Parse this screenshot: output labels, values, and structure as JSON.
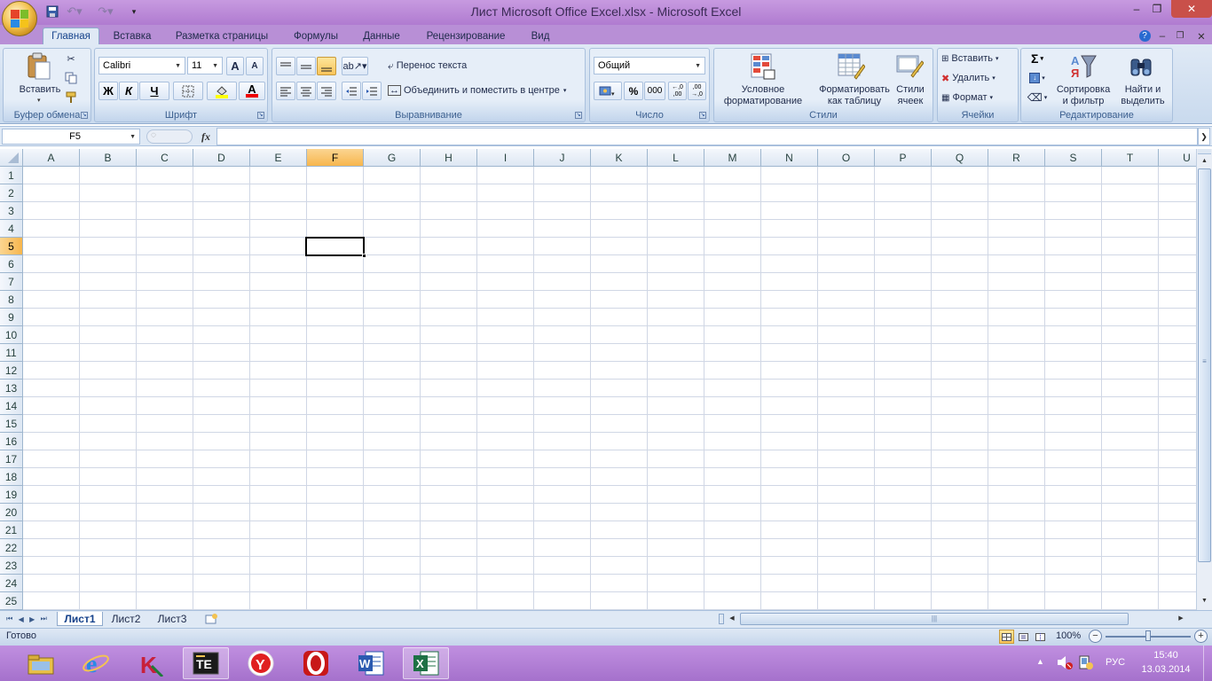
{
  "window": {
    "title": "Лист Microsoft Office Excel.xlsx - Microsoft Excel",
    "controls": {
      "minimize": "–",
      "restore": "❐",
      "close": "✕"
    }
  },
  "ribbon_tabs": [
    "Главная",
    "Вставка",
    "Разметка страницы",
    "Формулы",
    "Данные",
    "Рецензирование",
    "Вид"
  ],
  "ribbon": {
    "clipboard": {
      "label": "Буфер обмена",
      "paste": "Вставить"
    },
    "font": {
      "label": "Шрифт",
      "name": "Calibri",
      "size": "11",
      "bold": "Ж",
      "italic": "К",
      "underline": "Ч",
      "grow": "A",
      "shrink": "A",
      "color_letter": "A"
    },
    "alignment": {
      "label": "Выравнивание",
      "wrap": "Перенос текста",
      "merge": "Объединить и поместить в центре"
    },
    "number": {
      "label": "Число",
      "format": "Общий",
      "percent": "%",
      "thousands": "000",
      "inc_dec": "←,0 ,00",
      "dec_dec": ",00 →,0"
    },
    "styles": {
      "label": "Стили",
      "conditional_1": "Условное",
      "conditional_2": "форматирование",
      "table_1": "Форматировать",
      "table_2": "как таблицу",
      "cell_1": "Стили",
      "cell_2": "ячеек"
    },
    "cells": {
      "label": "Ячейки",
      "insert": "Вставить",
      "delete": "Удалить",
      "format": "Формат"
    },
    "editing": {
      "label": "Редактирование",
      "sort_1": "Сортировка",
      "sort_2": "и фильтр",
      "find_1": "Найти и",
      "find_2": "выделить",
      "sigma": "Σ"
    }
  },
  "formula_bar": {
    "name_box": "F5",
    "fx": "fx",
    "value": ""
  },
  "grid": {
    "columns": [
      "A",
      "B",
      "C",
      "D",
      "E",
      "F",
      "G",
      "H",
      "I",
      "J",
      "K",
      "L",
      "M",
      "N",
      "O",
      "P",
      "Q",
      "R",
      "S",
      "T",
      "U"
    ],
    "rows": [
      "1",
      "2",
      "3",
      "4",
      "5",
      "6",
      "7",
      "8",
      "9",
      "10",
      "11",
      "12",
      "13",
      "14",
      "15",
      "16",
      "17",
      "18",
      "19",
      "20",
      "21",
      "22",
      "23",
      "24",
      "25"
    ],
    "selected_column": "F",
    "selected_row": "5"
  },
  "sheets": [
    "Лист1",
    "Лист2",
    "Лист3"
  ],
  "status": {
    "text": "Готово",
    "zoom": "100%"
  },
  "taskbar": {
    "apps": [
      "file-explorer",
      "internet-explorer",
      "kaspersky",
      "total-commander",
      "yandex-browser",
      "opera",
      "microsoft-word",
      "microsoft-excel"
    ],
    "lang": "РУС",
    "time": "15:40",
    "date": "13.03.2014"
  },
  "colors": {
    "accent": "#b07bd0",
    "ribbon": "#dfe9f5",
    "selected_header": "#f7b64d",
    "excel_green": "#1e7145"
  }
}
